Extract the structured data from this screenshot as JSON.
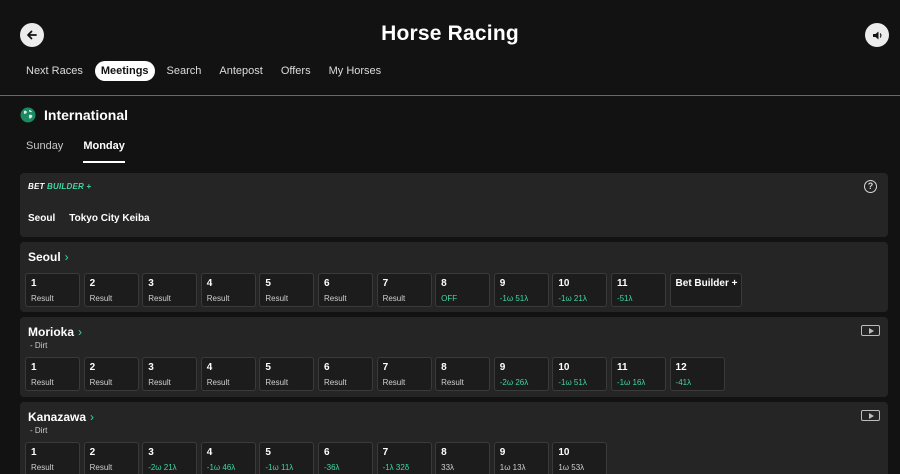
{
  "header": {
    "title": "Horse Racing",
    "back_icon": "arrow-left-icon",
    "sound_icon": "speaker-icon"
  },
  "nav": [
    {
      "label": "Next Races",
      "active": false
    },
    {
      "label": "Meetings",
      "active": true
    },
    {
      "label": "Search",
      "active": false
    },
    {
      "label": "Antepost",
      "active": false
    },
    {
      "label": "Offers",
      "active": false
    },
    {
      "label": "My Horses",
      "active": false
    }
  ],
  "section": {
    "title": "International",
    "icon": "globe-icon"
  },
  "days": [
    {
      "label": "Sunday",
      "active": false
    },
    {
      "label": "Monday",
      "active": true
    }
  ],
  "bet_builder": {
    "logo_a": "BET ",
    "logo_b": "BUILDER +",
    "help_label": "?",
    "meetings": [
      "Seoul",
      "Tokyo City Keiba"
    ]
  },
  "meetings": [
    {
      "name": "Seoul",
      "surface": "",
      "video": false,
      "races": [
        {
          "num": "1",
          "status": "Result",
          "green": false
        },
        {
          "num": "2",
          "status": "Result",
          "green": false
        },
        {
          "num": "3",
          "status": "Result",
          "green": false
        },
        {
          "num": "4",
          "status": "Result",
          "green": false
        },
        {
          "num": "5",
          "status": "Result",
          "green": false
        },
        {
          "num": "6",
          "status": "Result",
          "green": false
        },
        {
          "num": "7",
          "status": "Result",
          "green": false
        },
        {
          "num": "8",
          "status": "OFF",
          "green": true
        },
        {
          "num": "9",
          "status": "-1ω 51λ",
          "green": true
        },
        {
          "num": "10",
          "status": "-1ω 21λ",
          "green": true
        },
        {
          "num": "11",
          "status": "-51λ",
          "green": true
        },
        {
          "num": "Bet Builder +",
          "status": "",
          "green": false,
          "wide": true
        }
      ]
    },
    {
      "name": "Morioka",
      "surface": "- Dirt",
      "video": true,
      "races": [
        {
          "num": "1",
          "status": "Result",
          "green": false
        },
        {
          "num": "2",
          "status": "Result",
          "green": false
        },
        {
          "num": "3",
          "status": "Result",
          "green": false
        },
        {
          "num": "4",
          "status": "Result",
          "green": false
        },
        {
          "num": "5",
          "status": "Result",
          "green": false
        },
        {
          "num": "6",
          "status": "Result",
          "green": false
        },
        {
          "num": "7",
          "status": "Result",
          "green": false
        },
        {
          "num": "8",
          "status": "Result",
          "green": false
        },
        {
          "num": "9",
          "status": "-2ω 26λ",
          "green": true
        },
        {
          "num": "10",
          "status": "-1ω 51λ",
          "green": true
        },
        {
          "num": "11",
          "status": "-1ω 16λ",
          "green": true
        },
        {
          "num": "12",
          "status": "-41λ",
          "green": true
        }
      ]
    },
    {
      "name": "Kanazawa",
      "surface": "- Dirt",
      "video": true,
      "races": [
        {
          "num": "1",
          "status": "Result",
          "green": false
        },
        {
          "num": "2",
          "status": "Result",
          "green": false
        },
        {
          "num": "3",
          "status": "-2ω 21λ",
          "green": true
        },
        {
          "num": "4",
          "status": "-1ω 46λ",
          "green": true
        },
        {
          "num": "5",
          "status": "-1ω 11λ",
          "green": true
        },
        {
          "num": "6",
          "status": "-36λ",
          "green": true
        },
        {
          "num": "7",
          "status": "-1λ 32δ",
          "green": true
        },
        {
          "num": "8",
          "status": "33λ",
          "green": false
        },
        {
          "num": "9",
          "status": "1ω 13λ",
          "green": false
        },
        {
          "num": "10",
          "status": "1ω 53λ",
          "green": false
        }
      ]
    }
  ]
}
